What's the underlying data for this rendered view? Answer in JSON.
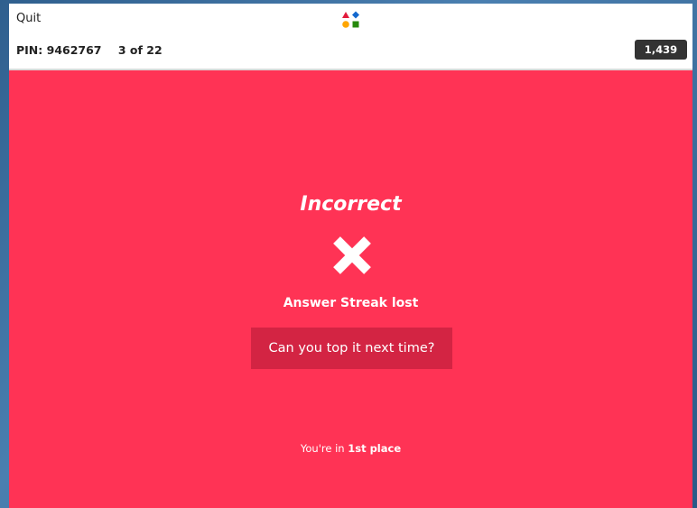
{
  "header": {
    "quit_label": "Quit",
    "pin": "PIN: 9462767",
    "question_progress": "3 of 22",
    "score": "1,439",
    "logo_icon": "kahoot-shapes-icon"
  },
  "result": {
    "title": "Incorrect",
    "icon": "close-x-icon",
    "streak_message": "Answer Streak lost",
    "encouragement": "Can you top it next time?",
    "place_prefix": "You're in",
    "place_value": "1st place"
  },
  "colors": {
    "background": "#ff3355",
    "cta_box": "#d32443",
    "score_badge": "#333333",
    "logo_triangle": "#e21b3c",
    "logo_diamond": "#1368ce",
    "logo_circle": "#ffa602",
    "logo_square": "#26890c"
  }
}
